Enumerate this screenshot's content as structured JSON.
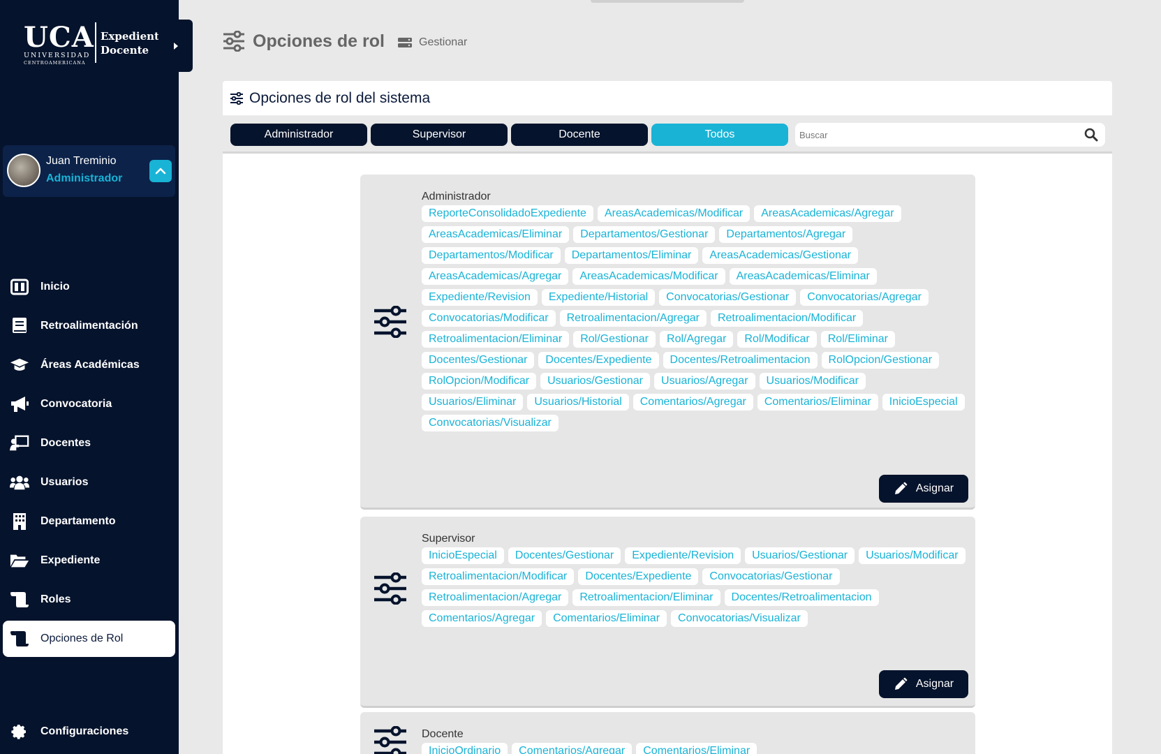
{
  "brand": {
    "uca": "UCA",
    "universidad": "UNIVERSIDAD",
    "centroamericana": "CENTROAMERICANA",
    "app_line1": "Expediente",
    "app_line2": "Docente"
  },
  "user": {
    "name": "Juan Treminio",
    "role": "Administrador"
  },
  "nav": [
    {
      "label": "Inicio",
      "icon": "columns-icon"
    },
    {
      "label": "Retroalimentación",
      "icon": "book-icon"
    },
    {
      "label": "Áreas Académicas",
      "icon": "graduation-cap-icon"
    },
    {
      "label": "Convocatoria",
      "icon": "megaphone-icon"
    },
    {
      "label": "Docentes",
      "icon": "chalkboard-teacher-icon"
    },
    {
      "label": "Usuarios",
      "icon": "users-icon"
    },
    {
      "label": "Departamento",
      "icon": "building-icon"
    },
    {
      "label": "Expediente",
      "icon": "folder-open-icon"
    },
    {
      "label": "Roles",
      "icon": "scroll-icon"
    },
    {
      "label": "Opciones de Rol",
      "icon": "scroll-icon",
      "active": true
    }
  ],
  "settings_label": "Configuraciones",
  "page": {
    "title": "Opciones de rol",
    "breadcrumb": "Gestionar"
  },
  "panel": {
    "title": "Opciones de rol del sistema",
    "filters": [
      "Administrador",
      "Supervisor",
      "Docente",
      "Todos"
    ],
    "selected_filter": "Todos",
    "search_placeholder": "Buscar"
  },
  "assign_label": "Asignar",
  "roles": [
    {
      "name": "Administrador",
      "options": [
        "ReporteConsolidadoExpediente",
        "AreasAcademicas/Modificar",
        "AreasAcademicas/Agregar",
        "AreasAcademicas/Eliminar",
        "Departamentos/Gestionar",
        "Departamentos/Agregar",
        "Departamentos/Modificar",
        "Departamentos/Eliminar",
        "AreasAcademicas/Gestionar",
        "AreasAcademicas/Agregar",
        "AreasAcademicas/Modificar",
        "AreasAcademicas/Eliminar",
        "Expediente/Revision",
        "Expediente/Historial",
        "Convocatorias/Gestionar",
        "Convocatorias/Agregar",
        "Convocatorias/Modificar",
        "Retroalimentacion/Agregar",
        "Retroalimentacion/Modificar",
        "Retroalimentacion/Eliminar",
        "Rol/Gestionar",
        "Rol/Agregar",
        "Rol/Modificar",
        "Rol/Eliminar",
        "Docentes/Gestionar",
        "Docentes/Expediente",
        "Docentes/Retroalimentacion",
        "RolOpcion/Gestionar",
        "RolOpcion/Modificar",
        "Usuarios/Gestionar",
        "Usuarios/Agregar",
        "Usuarios/Modificar",
        "Usuarios/Eliminar",
        "Usuarios/Historial",
        "Comentarios/Agregar",
        "Comentarios/Eliminar",
        "InicioEspecial",
        "Convocatorias/Visualizar"
      ]
    },
    {
      "name": "Supervisor",
      "options": [
        "InicioEspecial",
        "Docentes/Gestionar",
        "Expediente/Revision",
        "Usuarios/Gestionar",
        "Usuarios/Modificar",
        "Retroalimentacion/Modificar",
        "Docentes/Expediente",
        "Convocatorias/Gestionar",
        "Retroalimentacion/Agregar",
        "Retroalimentacion/Eliminar",
        "Docentes/Retroalimentacion",
        "Comentarios/Agregar",
        "Comentarios/Eliminar",
        "Convocatorias/Visualizar"
      ]
    },
    {
      "name": "Docente",
      "options": [
        "InicioOrdinario",
        "Comentarios/Agregar",
        "Comentarios/Eliminar"
      ]
    }
  ]
}
